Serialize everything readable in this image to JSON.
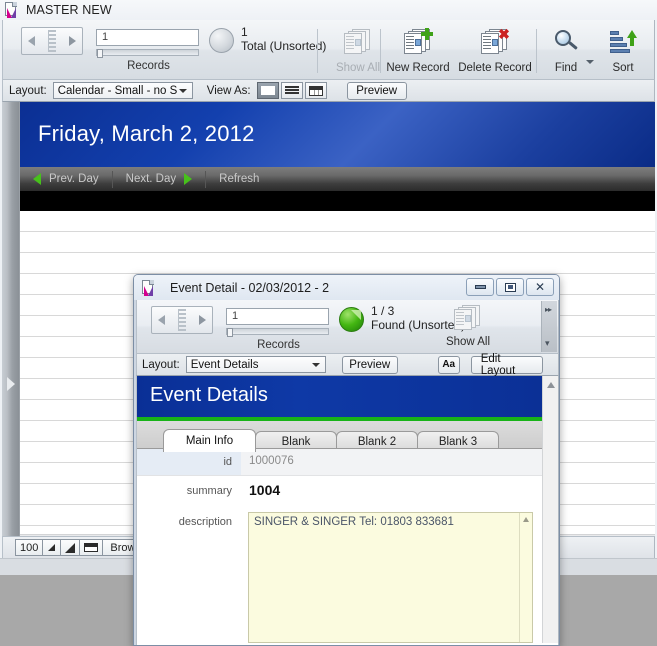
{
  "main_window": {
    "title": "MASTER NEW",
    "icon": "filemaker-document-icon",
    "toolbar": {
      "record_value": "1",
      "records_label": "Records",
      "count_number": "1",
      "count_label": "Total (Unsorted)",
      "buttons": [
        {
          "label": "Show All",
          "icon": "show-all-icon",
          "disabled": true
        },
        {
          "label": "New Record",
          "icon": "new-record-icon",
          "disabled": false
        },
        {
          "label": "Delete Record",
          "icon": "delete-record-icon",
          "disabled": false
        },
        {
          "label": "Find",
          "icon": "find-icon",
          "disabled": false
        },
        {
          "label": "Sort",
          "icon": "sort-icon",
          "disabled": false
        }
      ]
    },
    "layout_bar": {
      "layout_label": "Layout:",
      "layout_value": "Calendar - Small - no Si...",
      "view_as_label": "View As:",
      "view_modes": [
        "form-view-icon",
        "list-view-icon",
        "table-view-icon"
      ],
      "active_view": 0,
      "preview_label": "Preview"
    },
    "calendar": {
      "day_title": "Friday, March 2, 2012",
      "nav": {
        "prev_label": "Prev. Day",
        "next_label": "Next. Day",
        "refresh_label": "Refresh"
      }
    },
    "status_bar": {
      "zoom_level": "100",
      "zoom_out_icon": "zoom-out-icon",
      "zoom_in_icon": "zoom-in-icon",
      "window_toggle_icon": "status-toolbar-toggle-icon",
      "mode_label": "Browse"
    }
  },
  "dialog": {
    "title": "Event Detail  -  02/03/2012 - 2",
    "icon": "filemaker-document-icon",
    "window_controls": {
      "minimize": "minimize-icon",
      "maximize": "maximize-icon",
      "close": "close-icon"
    },
    "toolbar": {
      "record_value": "1",
      "records_label": "Records",
      "count_number": "1 / 3",
      "count_label": "Found (Unsorted)",
      "show_all_label": "Show All",
      "show_all_icon": "show-all-icon"
    },
    "layout_bar": {
      "layout_label": "Layout:",
      "layout_value": "Event Details",
      "preview_label": "Preview",
      "text_format_label": "Aa",
      "edit_layout_label": "Edit Layout"
    },
    "content": {
      "header_title": "Event Details",
      "tabs": [
        {
          "label": "Main Info",
          "active": true
        },
        {
          "label": "Blank",
          "active": false
        },
        {
          "label": "Blank 2",
          "active": false
        },
        {
          "label": "Blank 3",
          "active": false
        }
      ],
      "fields": [
        {
          "label": "id",
          "value": "1000076"
        },
        {
          "label": "summary",
          "value": "1004"
        },
        {
          "label": "description",
          "value": "SINGER & SINGER Tel: 01803 833681"
        }
      ]
    }
  },
  "colors": {
    "calendar_header_blue": "#0e3aa6",
    "dialog_header_blue": "#0b3096",
    "accent_green": "#18b318",
    "nav_arrow_green": "#47c11b",
    "textarea_yellow": "#fbfbdf",
    "desktop_gray": "#a8a8a8"
  }
}
